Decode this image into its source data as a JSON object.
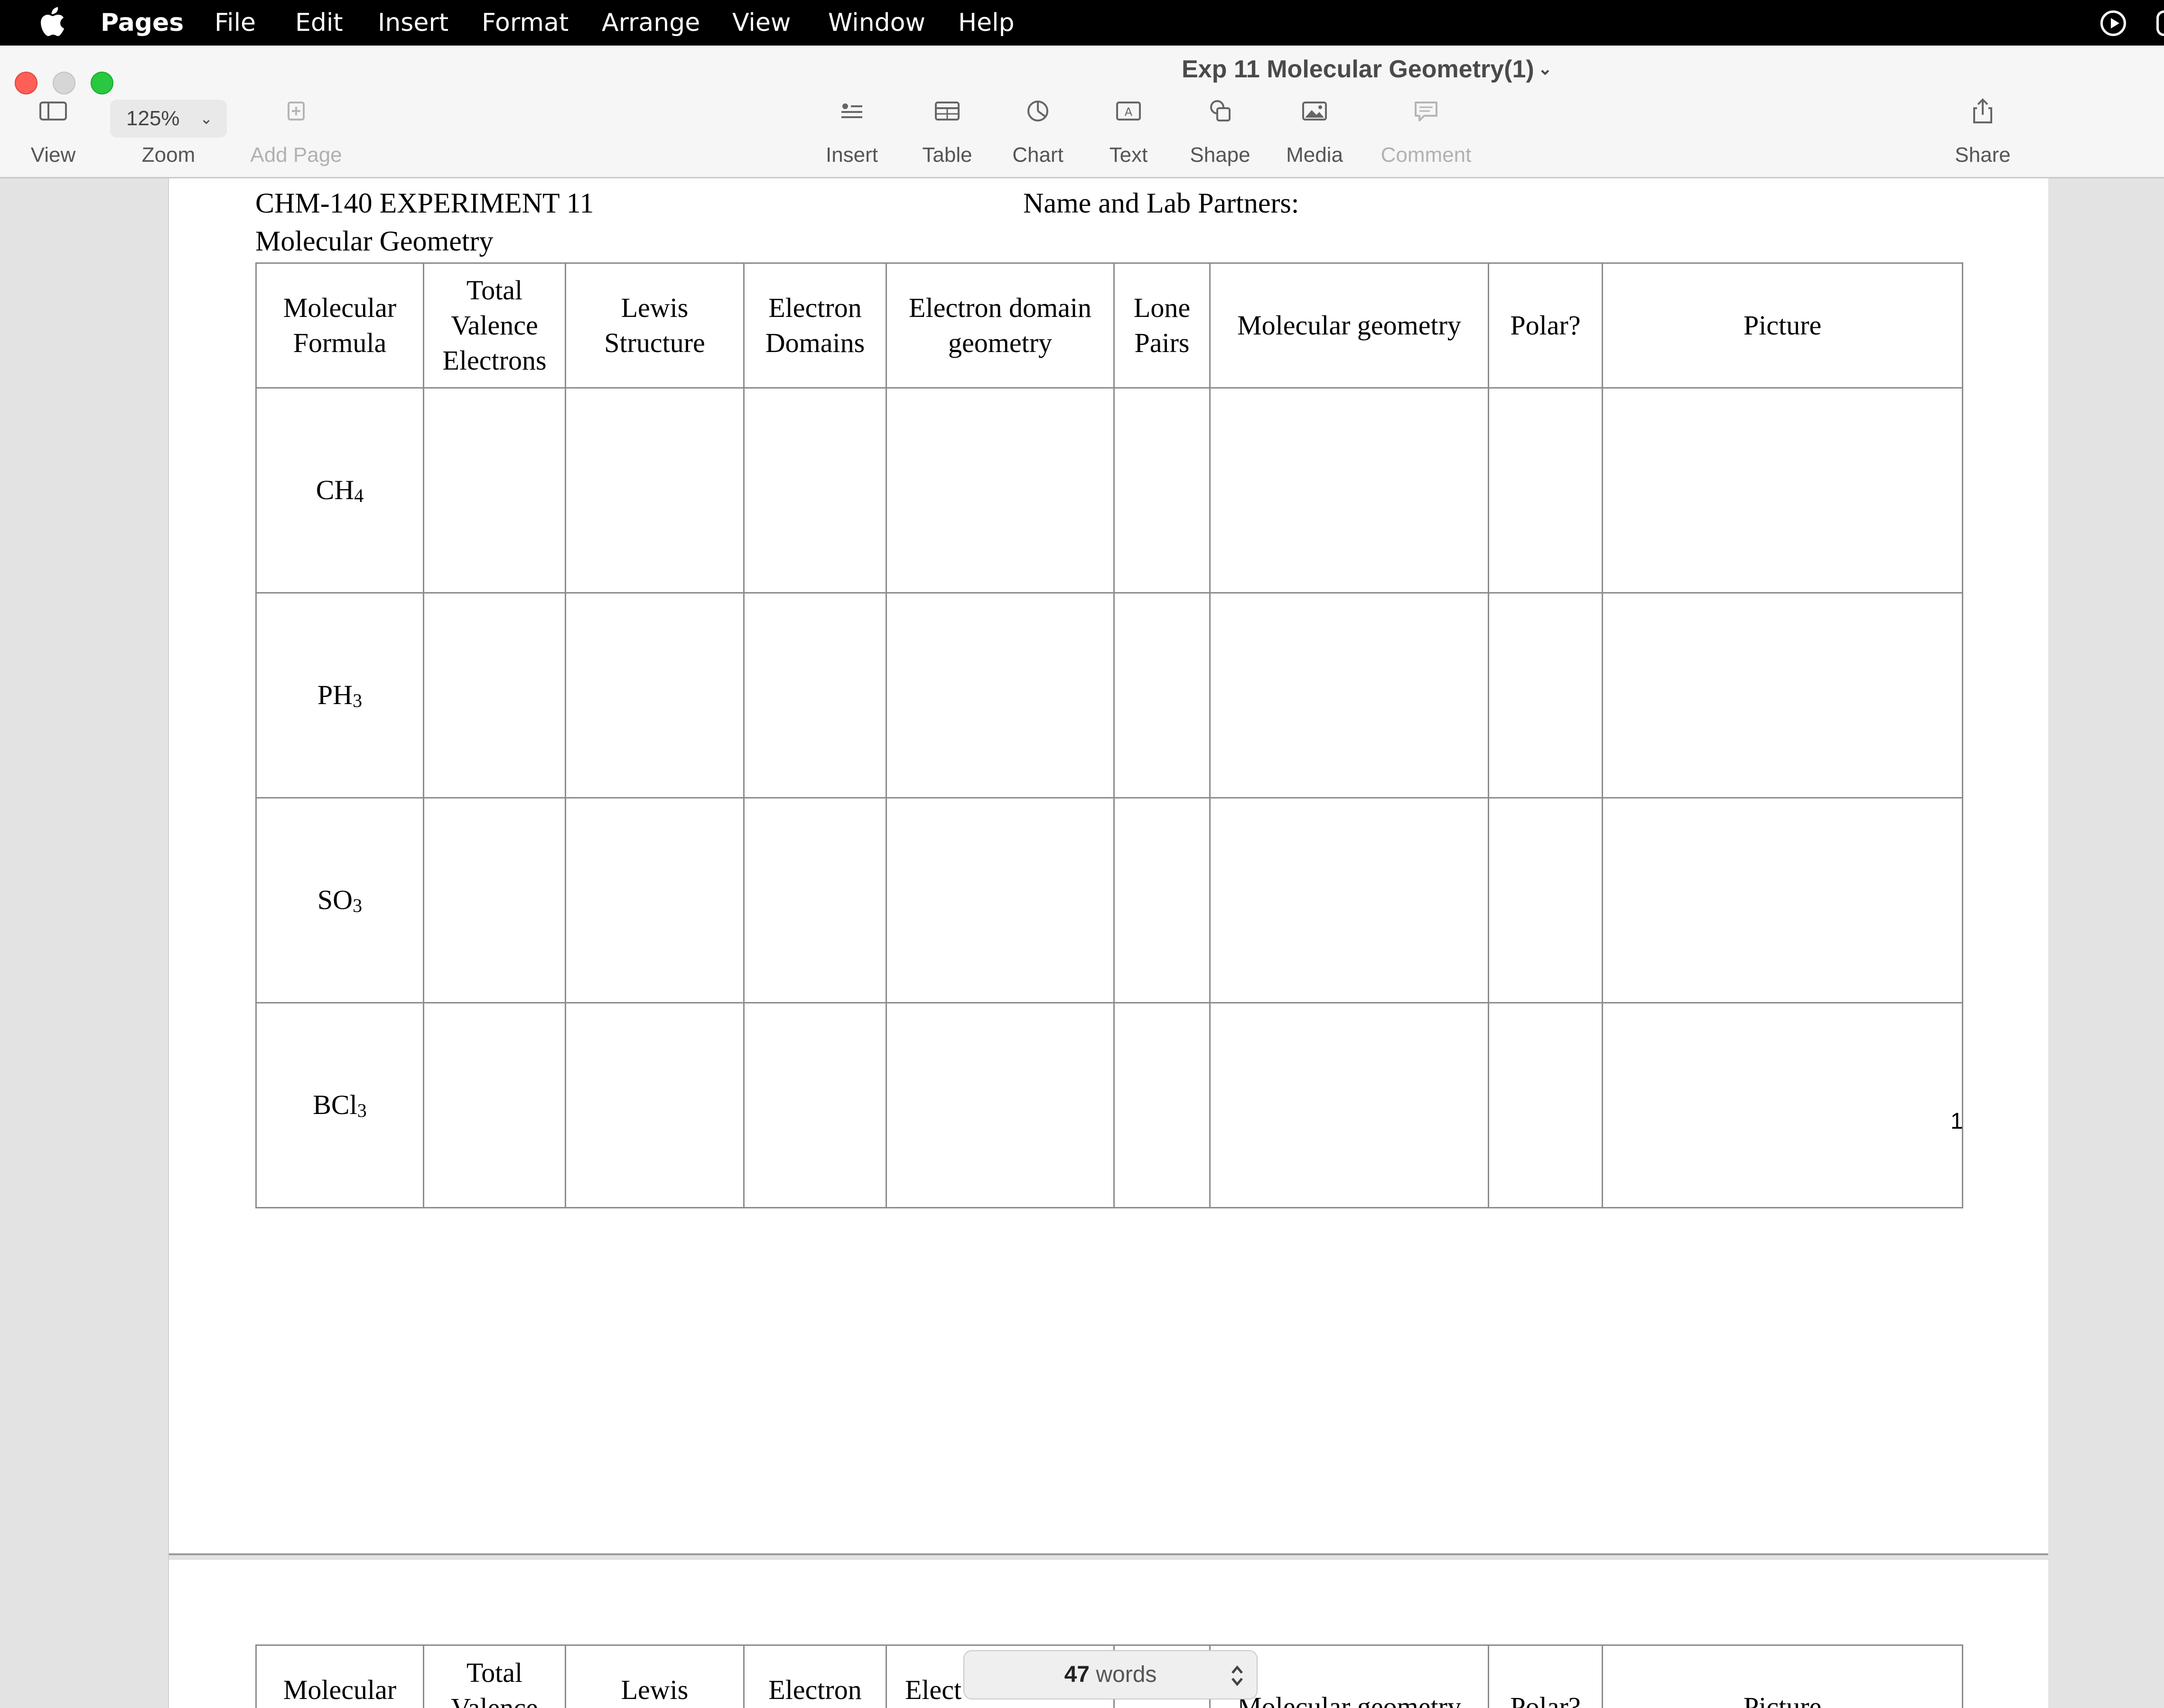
{
  "menubar": {
    "app": "Pages",
    "items": [
      "File",
      "Edit",
      "Insert",
      "Format",
      "Arrange",
      "View",
      "Window",
      "Help"
    ]
  },
  "window": {
    "title": "Exp 11 Molecular Geometry(1)"
  },
  "toolbar": {
    "view": "View",
    "zoom_value": "125%",
    "zoom": "Zoom",
    "add_page": "Add Page",
    "insert": "Insert",
    "table": "Table",
    "chart": "Chart",
    "text": "Text",
    "shape": "Shape",
    "media": "Media",
    "comment": "Comment",
    "share": "Share"
  },
  "document": {
    "course_line": "CHM-140 EXPERIMENT 11",
    "name_line": "Name and Lab Partners:",
    "subtitle": "Molecular Geometry",
    "headers": [
      [
        "Molecular",
        "Formula"
      ],
      [
        "Total",
        "Valence",
        "Electrons"
      ],
      [
        "Lewis",
        "Structure"
      ],
      [
        "Electron",
        "Domains"
      ],
      [
        "Electron domain",
        "geometry"
      ],
      [
        "Lone",
        "Pairs"
      ],
      [
        "Molecular geometry"
      ],
      [
        "Polar?"
      ],
      [
        "Picture"
      ]
    ],
    "rows": [
      {
        "base": "CH",
        "sub": "4"
      },
      {
        "base": "PH",
        "sub": "3"
      },
      {
        "base": "SO",
        "sub": "3"
      },
      {
        "base": "BCl",
        "sub": "3"
      }
    ],
    "page_number": "1",
    "page2_headers": [
      "Molecular",
      "Total",
      "Valence",
      "Lewis",
      "Electron",
      "Elect",
      "Molecular geometry",
      "Polar?",
      "Picture"
    ]
  },
  "status": {
    "word_count": "47",
    "word_label": "words"
  }
}
